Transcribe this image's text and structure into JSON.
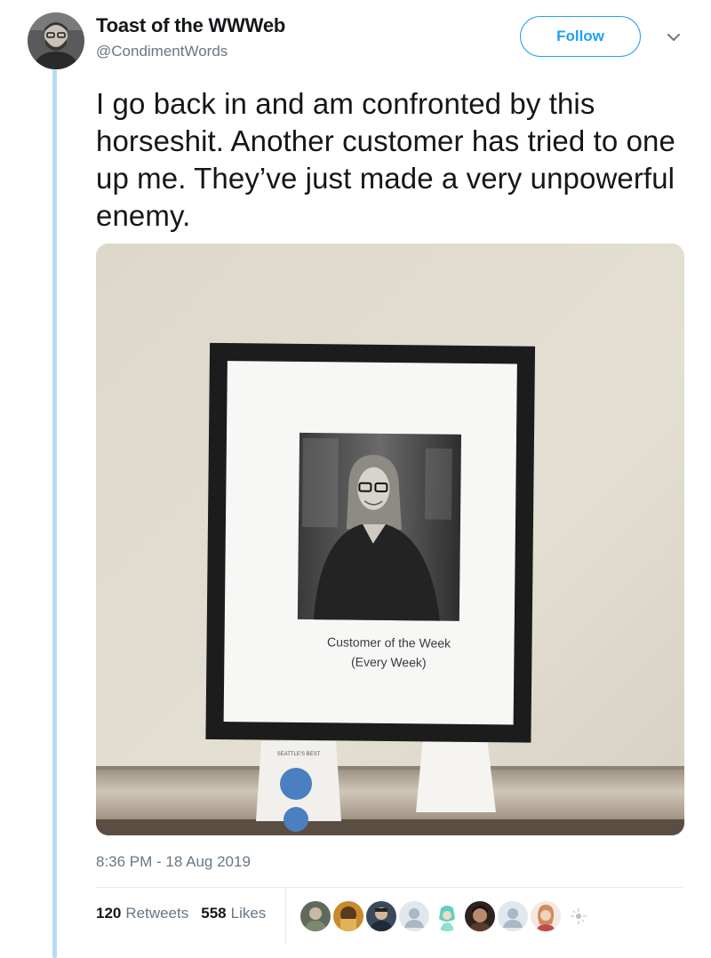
{
  "tweet": {
    "display_name": "Toast of the WWWeb",
    "handle": "@CondimentWords",
    "follow_label": "Follow",
    "text": "I go back in and am confronted by this horseshit. Another customer has tried to one up me. They’ve just made a very unpowerful enemy.",
    "timestamp": "8:36 PM - 18 Aug 2019",
    "retweets_count": "120",
    "retweets_label": "Retweets",
    "likes_count": "558",
    "likes_label": "Likes"
  },
  "photo": {
    "caption_line1": "Customer of the Week",
    "caption_line2": "(Every Week)",
    "cup_print": "SEATTLE'S BEST"
  },
  "icons": {
    "caret": "chevron-down-icon",
    "avatar": "user-avatar"
  },
  "colors": {
    "accent": "#1da1f2",
    "thread_line": "#b6dcf5",
    "muted_text": "#657786"
  }
}
